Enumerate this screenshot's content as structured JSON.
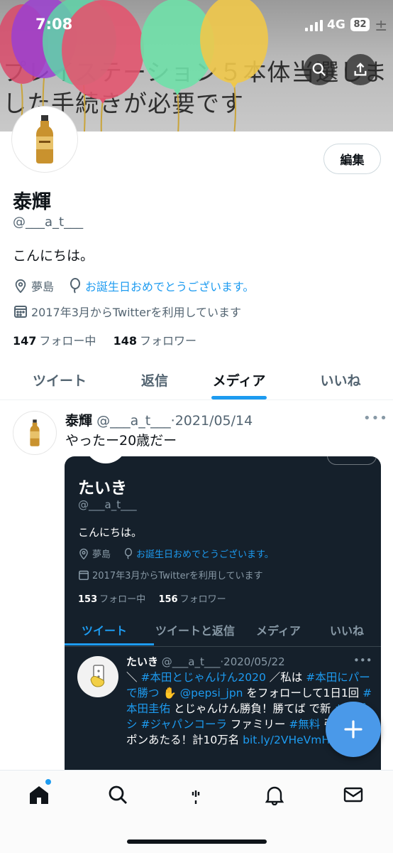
{
  "status_bar": {
    "time": "7:08",
    "network": "4G",
    "battery": "82"
  },
  "banner": {
    "text": "プレイステーション５本体当選しました手続きが必要です"
  },
  "profile": {
    "edit_label": "編集",
    "name": "泰輝",
    "handle": "@___a_t___",
    "bio": "こんにちは。",
    "location": "夢島",
    "birthday": "お誕生日おめでとうございます。",
    "joined": "2017年3月からTwitterを利用しています",
    "following_count": "147",
    "following_label": "フォロー中",
    "followers_count": "148",
    "followers_label": "フォロワー"
  },
  "tabs": [
    {
      "label": "ツイート"
    },
    {
      "label": "返信"
    },
    {
      "label": "メディア"
    },
    {
      "label": "いいね"
    }
  ],
  "tweet": {
    "name": "泰輝",
    "handle": "@___a_t___",
    "separator": "·",
    "date": "2021/05/14",
    "more": "•••",
    "text": "やったー20歳だー"
  },
  "embedded": {
    "name": "たいき",
    "handle": "@___a_t___",
    "bio": "こんにちは。",
    "location": "夢島",
    "birthday": "お誕生日おめでとうございます。",
    "joined": "2017年3月からTwitterを利用しています",
    "following_count": "153",
    "following_label": "フォロー中",
    "followers_count": "156",
    "followers_label": "フォロワー",
    "tabs": [
      {
        "label": "ツイート"
      },
      {
        "label": "ツイートと返信"
      },
      {
        "label": "メディア"
      },
      {
        "label": "いいね"
      }
    ],
    "tweet": {
      "name": "たいき",
      "handle": "@___a_t___",
      "separator": "·",
      "date": "2020/05/22",
      "more": "•••",
      "body_segments": [
        {
          "t": "＼ ",
          "tag": false
        },
        {
          "t": "#本田とじゃんけん2020",
          "tag": true
        },
        {
          "t": " ／私は ",
          "tag": false
        },
        {
          "t": "#本田にパー で勝つ",
          "tag": true
        },
        {
          "t": " ✋ ",
          "tag": false
        },
        {
          "t": "@pepsi_jpn",
          "tag": true
        },
        {
          "t": " をフォローして1日1回 ",
          "tag": false
        },
        {
          "t": "#本田圭佑",
          "tag": true
        },
        {
          "t": " とじゃんけん勝負！勝てば で新 ",
          "tag": false
        },
        {
          "t": "#ペプシ",
          "tag": true
        },
        {
          "t": " ",
          "tag": false
        },
        {
          "t": "#ジャパンコーラ",
          "tag": true
        },
        {
          "t": " ファミリー ",
          "tag": false
        },
        {
          "t": "#無料",
          "tag": true
        },
        {
          "t": " 引換クーポンあたる！計10万名 ",
          "tag": false
        },
        {
          "t": "bit.ly/2VHeVmH",
          "tag": true
        }
      ]
    }
  },
  "colors": {
    "accent": "#1d9bf0",
    "fab": "#4a99e9",
    "dark_bg": "#15202b"
  },
  "icons": [
    "search-icon",
    "share-icon",
    "location-pin-icon",
    "balloon-icon",
    "calendar-icon",
    "plus-icon",
    "home-icon",
    "spaces-icon",
    "bell-icon",
    "mail-icon"
  ]
}
